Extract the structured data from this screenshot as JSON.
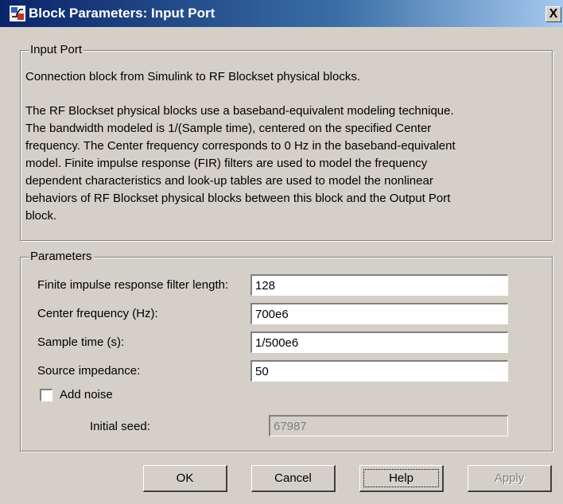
{
  "window": {
    "title": "Block Parameters: Input Port",
    "close_label": "X"
  },
  "description": {
    "group_label": "Input Port",
    "line1": "Connection block from Simulink to RF Blockset physical blocks.",
    "para2": [
      "The RF Blockset physical blocks use a baseband-equivalent modeling technique.",
      "The bandwidth modeled is 1/(Sample time), centered on the specified Center",
      "frequency. The Center frequency corresponds to 0 Hz in the baseband-equivalent",
      "model. Finite impulse response (FIR) filters are used to model the frequency",
      "dependent characteristics and look-up tables are used to model the nonlinear",
      "behaviors of RF Blockset physical blocks between this block and the Output Port",
      "block."
    ]
  },
  "parameters": {
    "group_label": "Parameters",
    "fir_length_label": "Finite impulse response filter length:",
    "fir_length_value": "128",
    "center_freq_label": "Center frequency (Hz):",
    "center_freq_value": "700e6",
    "sample_time_label": "Sample time (s):",
    "sample_time_value": "1/500e6",
    "source_impedance_label": "Source impedance:",
    "source_impedance_value": "50",
    "add_noise_label": "Add noise",
    "add_noise_checked": false,
    "initial_seed_label": "Initial seed:",
    "initial_seed_value": "67987"
  },
  "buttons": {
    "ok": "OK",
    "cancel": "Cancel",
    "help": "Help",
    "apply": "Apply"
  },
  "colors": {
    "dialog_bg": "#d4d0c8",
    "title_start": "#0a246a",
    "title_end": "#a6caf0"
  }
}
